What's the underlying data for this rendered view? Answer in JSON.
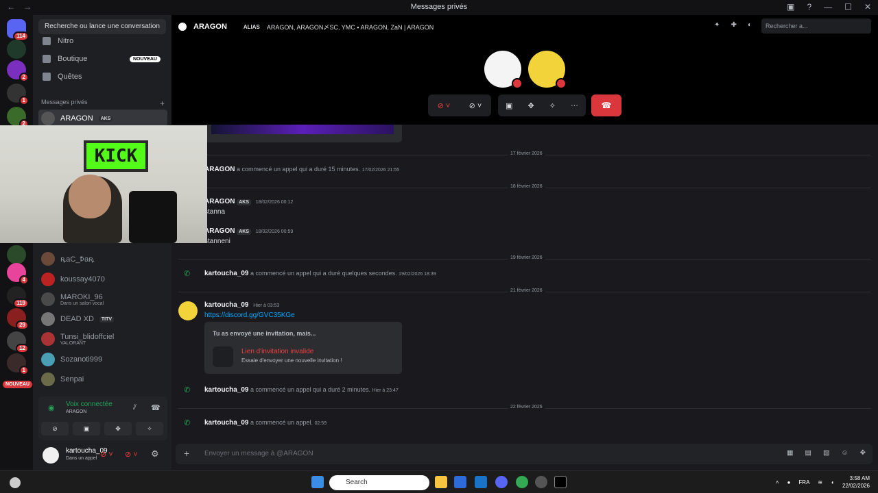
{
  "window": {
    "title": "Messages privés",
    "back": "←",
    "forward": "→"
  },
  "guilds": [
    {
      "badge": "114",
      "color": "#5865f2"
    },
    {
      "badge": "",
      "color": "#1f3a2a"
    },
    {
      "badge": "2",
      "color": "#7b2fbe"
    },
    {
      "badge": "1",
      "color": "#333"
    },
    {
      "badge": "2",
      "color": "#3a6b2a"
    },
    {
      "badge": "4",
      "color": "#e8449b"
    },
    {
      "badge": "119",
      "color": "#222"
    },
    {
      "badge": "29",
      "color": "#8a1f1f"
    },
    {
      "badge": "12",
      "color": "#444"
    },
    {
      "badge": "1",
      "color": "#3b2a2a"
    }
  ],
  "guild_new_label": "NOUVEAU",
  "sidebar": {
    "search": "Recherche ou lance une conversation",
    "nitro": "Nitro",
    "shop": "Boutique",
    "shop_badge": "NOUVEAU",
    "quests": "Quêtes",
    "dm_header": "Messages privés",
    "dms": [
      {
        "name": "ARAGON",
        "tag": "AKS",
        "sub": "",
        "color": "#555"
      },
      {
        "name": "ꝶaC_Ꝥaꝶ",
        "tag": "",
        "sub": "",
        "color": "#6b4a3a"
      },
      {
        "name": "koussay4070",
        "tag": "",
        "sub": "",
        "color": "#b22"
      },
      {
        "name": "MAROKI_96",
        "tag": "",
        "sub": "Dans un salon vocal",
        "color": "#4a4a4a"
      },
      {
        "name": "DEAD XD",
        "tag": "TITV",
        "sub": "",
        "color": "#777"
      },
      {
        "name": "Tunsi_blidoffciel",
        "tag": "",
        "sub": "VALORANT",
        "color": "#a33"
      },
      {
        "name": "Sozanoti999",
        "tag": "",
        "sub": "",
        "color": "#4a9fb5"
      },
      {
        "name": "Senpai",
        "tag": "",
        "sub": "",
        "color": "#6b6b4a"
      }
    ]
  },
  "voice": {
    "status": "Voix connectée",
    "channel": "ARAGON"
  },
  "user": {
    "name": "kartoucha_09",
    "status": "Dans un appel"
  },
  "header": {
    "channel_name": "ARAGON",
    "alias_label": "ALIAS",
    "aliases": "ARAGON, ARAGON〆SC, YMC ▪ ARAGON, ZaN | ARAGON",
    "search_placeholder": "Rechercher a..."
  },
  "chat": {
    "dates": [
      "17 février 2026",
      "18 février 2026",
      "19 février 2026",
      "21 février 2026",
      "22 février 2026"
    ],
    "call1": {
      "author": "ARAGON",
      "text": "a commencé un appel qui a duré 15 minutes.",
      "time": "17/02/2026 21:55"
    },
    "msg1": {
      "author": "ARAGON",
      "tag": "AKS",
      "time": "18/02/2026 00:12",
      "body": "stanna"
    },
    "msg2": {
      "author": "ARAGON",
      "tag": "AKS",
      "time": "18/02/2026 00:59",
      "body": "stanneni"
    },
    "call2": {
      "author": "kartoucha_09",
      "text": "a commencé un appel qui a duré quelques secondes.",
      "time": "19/02/2026 18:39"
    },
    "msg3": {
      "author": "kartoucha_09",
      "time": "Hier à 03:53",
      "link": "https://discord.gg/GVC35KGe"
    },
    "invite": {
      "heading": "Tu as envoyé une invitation, mais...",
      "title": "Lien d'invitation invalide",
      "subtitle": "Essaie d'envoyer une nouvelle invitation !"
    },
    "call3": {
      "author": "kartoucha_09",
      "text": "a commencé un appel qui a duré 2 minutes.",
      "time": "Hier à 23:47"
    },
    "call4": {
      "author": "kartoucha_09",
      "text": "a commencé un appel.",
      "time": "02:59"
    }
  },
  "composer": {
    "placeholder": "Envoyer un message à @ARAGON"
  },
  "webcam": {
    "sign": "KICK"
  },
  "taskbar": {
    "search": "Search",
    "lang": "FRA",
    "time": "3:58 AM",
    "date": "22/02/2026"
  }
}
